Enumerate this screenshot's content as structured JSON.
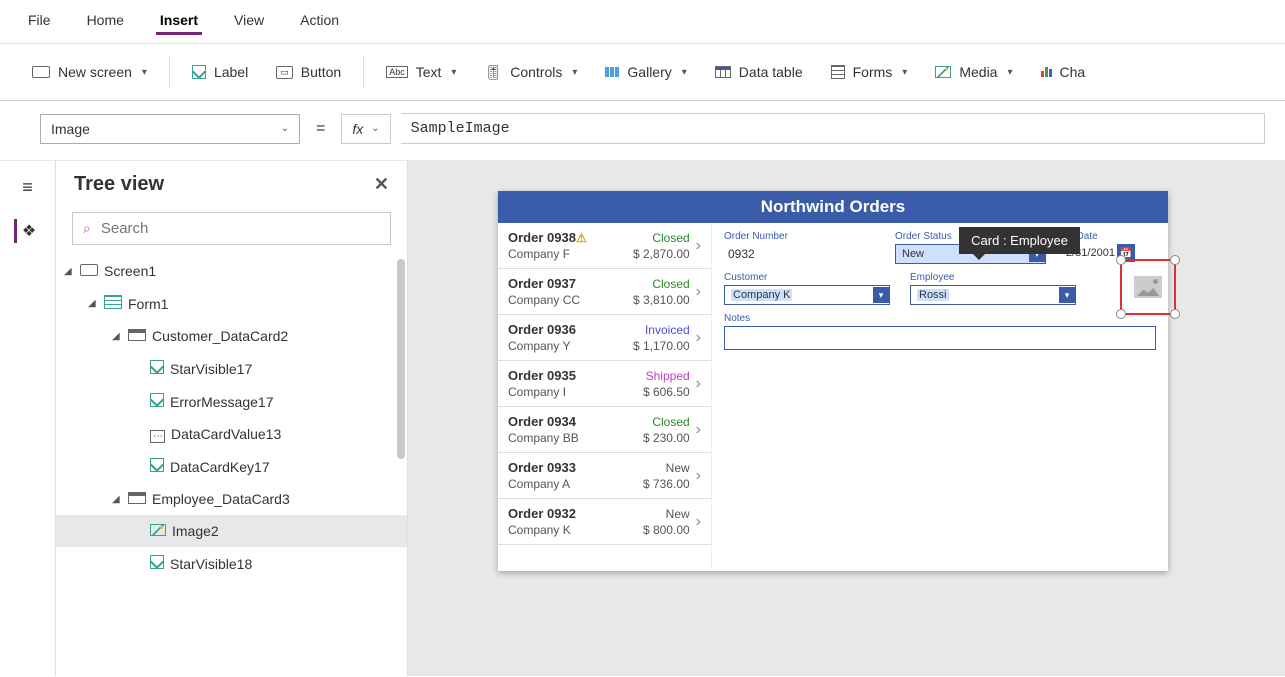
{
  "menubar": {
    "items": [
      "File",
      "Home",
      "Insert",
      "View",
      "Action"
    ],
    "active": "Insert"
  },
  "ribbon": {
    "new_screen": "New screen",
    "label": "Label",
    "button": "Button",
    "text": "Text",
    "controls": "Controls",
    "gallery": "Gallery",
    "data_table": "Data table",
    "forms": "Forms",
    "media": "Media",
    "charts": "Cha"
  },
  "formula": {
    "property": "Image",
    "fx_label": "fx",
    "value": "SampleImage"
  },
  "tree": {
    "title": "Tree view",
    "search_placeholder": "Search",
    "items": [
      {
        "level": 0,
        "expanded": true,
        "icon": "screen",
        "label": "Screen1"
      },
      {
        "level": 1,
        "expanded": true,
        "icon": "form",
        "label": "Form1"
      },
      {
        "level": 2,
        "expanded": true,
        "icon": "card",
        "label": "Customer_DataCard2"
      },
      {
        "level": 3,
        "icon": "edit",
        "label": "StarVisible17"
      },
      {
        "level": 3,
        "icon": "edit",
        "label": "ErrorMessage17"
      },
      {
        "level": 3,
        "icon": "dots",
        "label": "DataCardValue13"
      },
      {
        "level": 3,
        "icon": "edit",
        "label": "DataCardKey17"
      },
      {
        "level": 2,
        "expanded": true,
        "icon": "card",
        "label": "Employee_DataCard3"
      },
      {
        "level": 3,
        "icon": "image",
        "label": "Image2",
        "selected": true
      },
      {
        "level": 3,
        "icon": "edit",
        "label": "StarVisible18"
      }
    ]
  },
  "app": {
    "title": "Northwind Orders",
    "orders": [
      {
        "num": "Order 0938",
        "warn": true,
        "status": "Closed",
        "status_class": "closed",
        "company": "Company F",
        "amount": "$ 2,870.00"
      },
      {
        "num": "Order 0937",
        "status": "Closed",
        "status_class": "closed",
        "company": "Company CC",
        "amount": "$ 3,810.00"
      },
      {
        "num": "Order 0936",
        "status": "Invoiced",
        "status_class": "invoiced",
        "company": "Company Y",
        "amount": "$ 1,170.00"
      },
      {
        "num": "Order 0935",
        "status": "Shipped",
        "status_class": "shipped",
        "company": "Company I",
        "amount": "$ 606.50"
      },
      {
        "num": "Order 0934",
        "status": "Closed",
        "status_class": "closed",
        "company": "Company BB",
        "amount": "$ 230.00"
      },
      {
        "num": "Order 0933",
        "status": "New",
        "status_class": "new",
        "company": "Company A",
        "amount": "$ 736.00"
      },
      {
        "num": "Order 0932",
        "status": "New",
        "status_class": "new",
        "company": "Company K",
        "amount": "$ 800.00"
      }
    ],
    "detail": {
      "order_number_label": "Order Number",
      "order_number_value": "0932",
      "order_status_label": "Order Status",
      "order_status_value": "New",
      "paid_date_label": "id Date",
      "paid_date_value": "2/31/2001",
      "customer_label": "Customer",
      "customer_value": "Company K",
      "employee_label": "Employee",
      "employee_value": "Rossi",
      "notes_label": "Notes",
      "notes_value": ""
    },
    "tooltip": "Card : Employee"
  }
}
